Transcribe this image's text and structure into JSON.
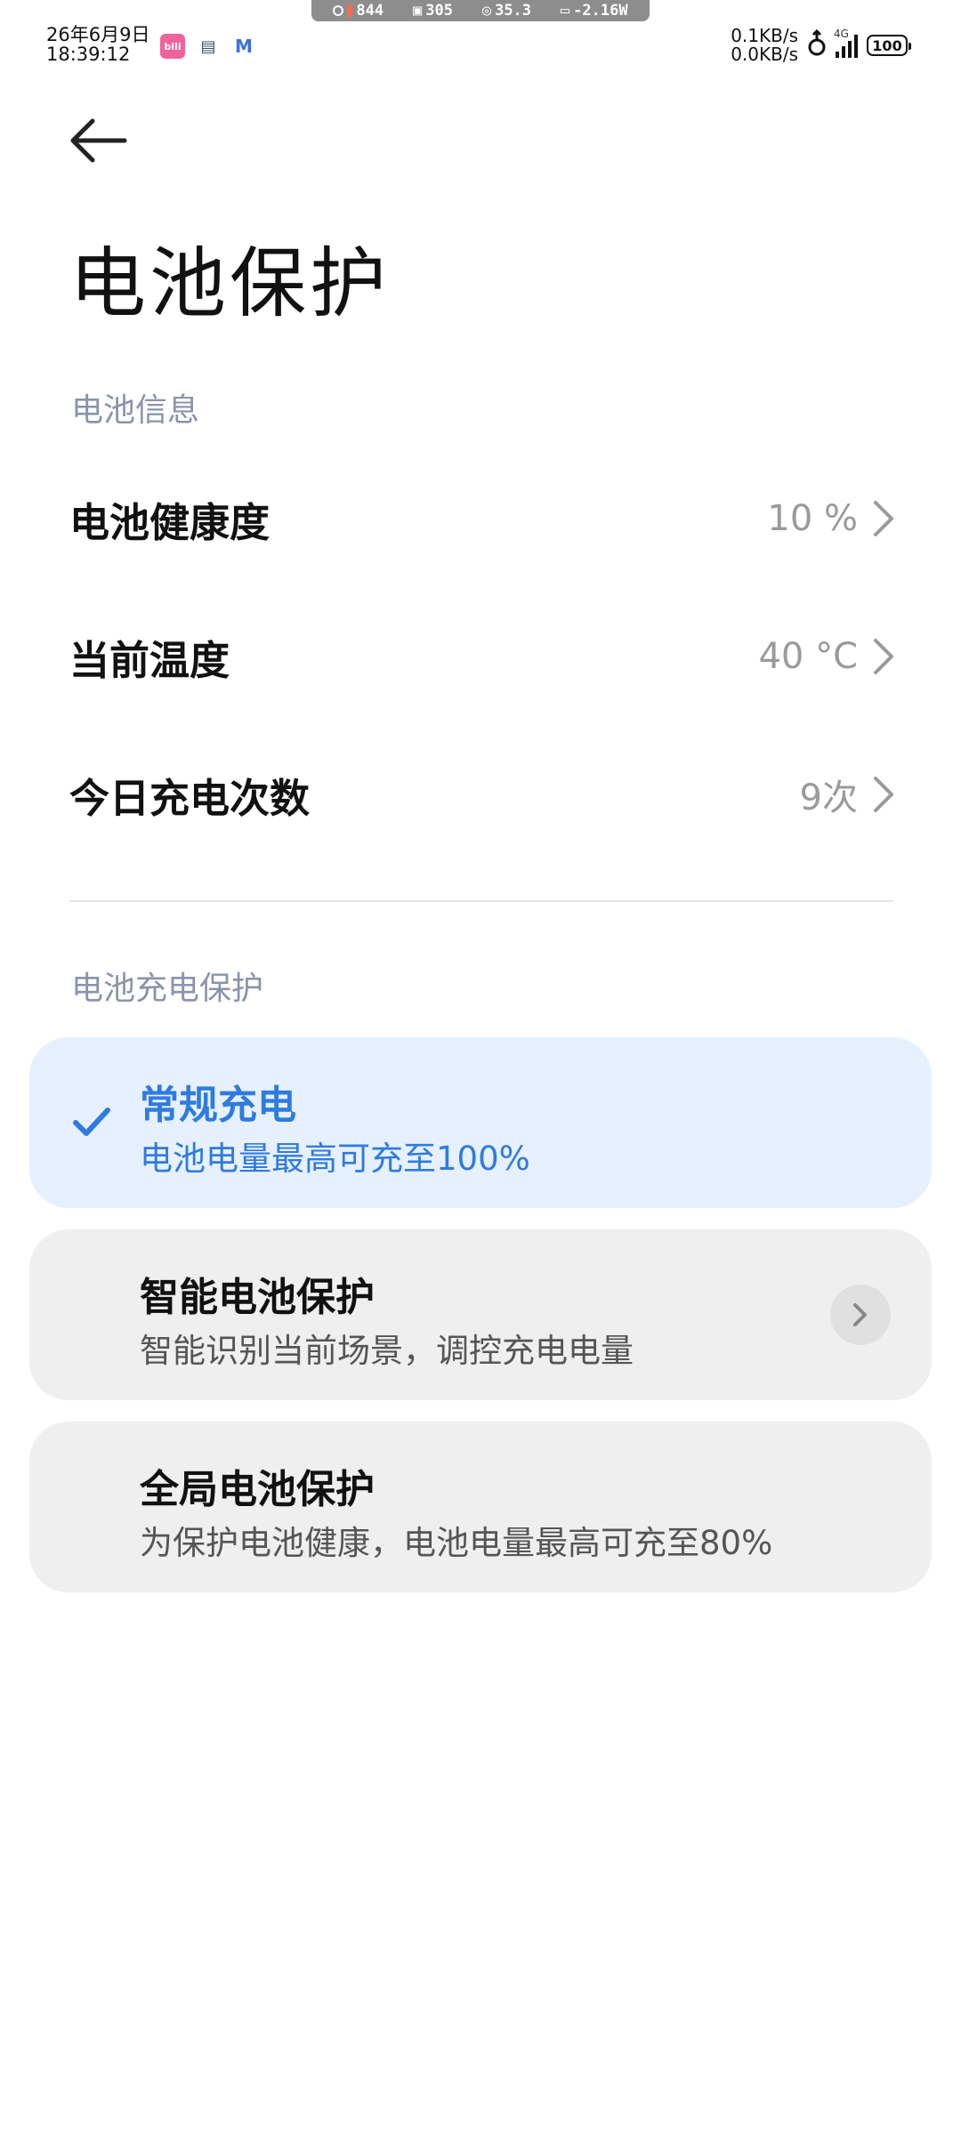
{
  "status_bar": {
    "date": "26年6月9日",
    "time": "18:39:12",
    "perf": {
      "fps": "844",
      "cpu": "305",
      "temp": "35.3",
      "power": "-2.16W"
    },
    "app_badge": "bilibili",
    "net_up": "0.1KB/s",
    "net_down": "0.0KB/s",
    "network_type": "4G",
    "battery": "100"
  },
  "header": {
    "title": "电池保护"
  },
  "battery_info": {
    "section_label": "电池信息",
    "rows": [
      {
        "label": "电池健康度",
        "value": "10 %"
      },
      {
        "label": "当前温度",
        "value": "40 °C"
      },
      {
        "label": "今日充电次数",
        "value": "9次"
      }
    ]
  },
  "charge_protection": {
    "section_label": "电池充电保护",
    "options": [
      {
        "title": "常规充电",
        "subtitle": "电池电量最高可充至100%",
        "selected": true
      },
      {
        "title": "智能电池保护",
        "subtitle": "智能识别当前场景，调控充电电量",
        "selected": false
      },
      {
        "title": "全局电池保护",
        "subtitle": "为保护电池健康，电池电量最高可充至80%",
        "selected": false
      }
    ]
  },
  "colors": {
    "accent": "#2f7be0",
    "selected_card_bg": "#e6f0fe",
    "card_bg": "#efefef",
    "section_label": "#8a93a8",
    "value_text": "#9a9a9a"
  },
  "icons": {
    "back": "arrow-left-icon",
    "chevron": "chevron-right-icon",
    "check": "checkmark-icon"
  }
}
